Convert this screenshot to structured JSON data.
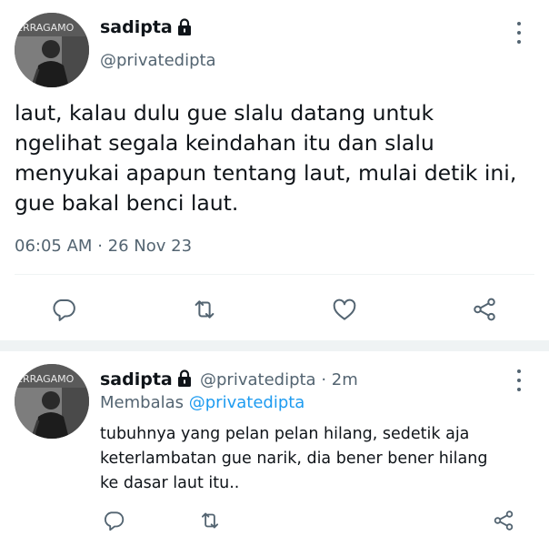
{
  "main_tweet": {
    "display_name": "sadipta",
    "handle": "@privatedipta",
    "avatar_sign_text": "ERRAGAMO",
    "text_lines": [
      "laut, kalau dulu gue slalu datang untuk",
      "ngelihat segala keindahan itu dan slalu",
      "menyukai apapun tentang laut, mulai detik ini,",
      "gue bakal benci laut."
    ],
    "time": "06:05 AM",
    "separator": "·",
    "date": "26 Nov 23"
  },
  "reply_tweet": {
    "display_name": "sadipta",
    "handle": "@privatedipta",
    "separator": "·",
    "age": "2m",
    "avatar_sign_text": "ERRAGAMO",
    "replying_label": "Membalas",
    "replying_handle": "@privatedipta",
    "text_lines": [
      "tubuhnya yang pelan pelan hilang, sedetik aja",
      "keterlambatan gue narik, dia bener bener hilang",
      "ke dasar laut itu.."
    ]
  },
  "icons": {
    "lock": "lock-icon",
    "more": "more-vertical-icon",
    "reply": "reply-icon",
    "retweet": "retweet-icon",
    "like": "like-heart-icon",
    "share": "share-icon"
  },
  "colors": {
    "text": "#0f1419",
    "secondary": "#536471",
    "link": "#1d9bf0",
    "divider": "#eff3f4"
  }
}
